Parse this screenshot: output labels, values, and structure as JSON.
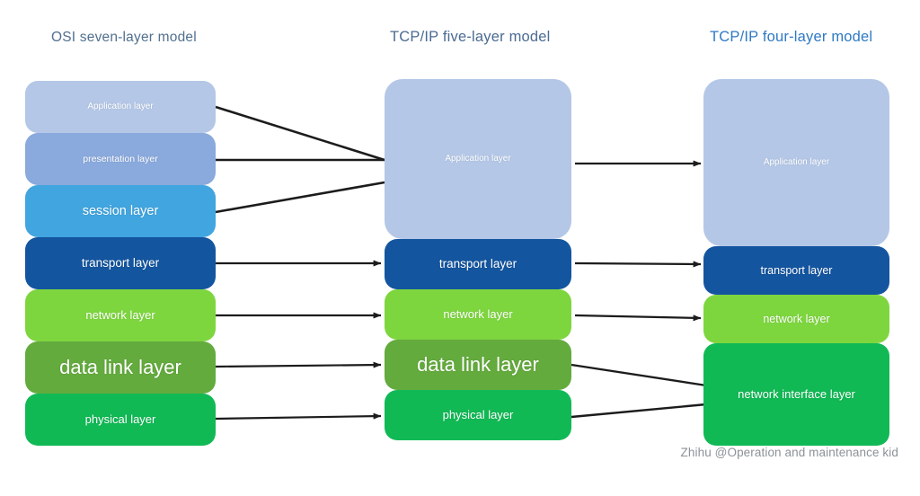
{
  "page": {
    "background": "#ffffff",
    "watermark": "Zhihu @Operation and maintenance kid"
  },
  "columns": [
    {
      "id": "osi",
      "title": "OSI seven-layer model",
      "title_color": "#51708f",
      "layers": [
        {
          "label": "Application layer",
          "color": "#b4c7e7",
          "text_size": "small"
        },
        {
          "label": "presentation layer",
          "color": "#8aa9dc",
          "text_size": "small"
        },
        {
          "label": "session layer",
          "color": "#41a5e0",
          "text_size": "medium"
        },
        {
          "label": "transport layer",
          "color": "#14559f",
          "text_size": "medium"
        },
        {
          "label": "network layer",
          "color": "#77d game",
          "text_size": "medium"
        },
        {
          "label": "data link layer",
          "color": "#64ab3e",
          "text_size": "xlarge"
        },
        {
          "label": "physical layer",
          "color": "#11b955",
          "text_size": "medium"
        }
      ]
    },
    {
      "id": "five",
      "title": "TCP/IP five-layer model",
      "title_color": "#4a6b93",
      "layers": [
        {
          "label": "Application layer",
          "color": "#b4c7e7",
          "text_size": "small"
        },
        {
          "label": "transport layer",
          "color": "#14559f",
          "text_size": "medium"
        },
        {
          "label": "network layer",
          "color": "#7ed63f",
          "text_size": "medium"
        },
        {
          "label": "data link layer",
          "color": "#64ab3e",
          "text_size": "xlarge"
        },
        {
          "label": "physical layer",
          "color": "#11b955",
          "text_size": "medium"
        }
      ]
    },
    {
      "id": "four",
      "title": "TCP/IP four-layer model",
      "title_color": "#2f79c4",
      "layers": [
        {
          "label": "Application layer",
          "color": "#b4c7e7",
          "text_size": "small"
        },
        {
          "label": "transport layer",
          "color": "#14559f",
          "text_size": "medium"
        },
        {
          "label": "network layer",
          "color": "#7ed63f",
          "text_size": "medium"
        },
        {
          "label": "network interface layer",
          "color": "#11b955",
          "text_size": "medium"
        }
      ]
    }
  ],
  "palette": {
    "osi_application": "#b4c7e7",
    "osi_presentation": "#8aa9dc",
    "osi_session": "#41a5e0",
    "transport": "#14559f",
    "network": "#7ed63f",
    "datalink": "#64ab3e",
    "physical": "#11b955",
    "connector": "#1c1c1c"
  },
  "connectors": {
    "osi_to_five": [
      "Application layer → Application layer",
      "presentation layer → Application layer",
      "session layer → Application layer",
      "transport layer → transport layer",
      "network layer → network layer",
      "data link layer → data link layer",
      "physical layer → physical layer"
    ],
    "five_to_four": [
      "Application layer → Application layer",
      "transport layer → transport layer",
      "network layer → network layer",
      "data link layer → network interface layer",
      "physical layer → network interface layer"
    ]
  }
}
